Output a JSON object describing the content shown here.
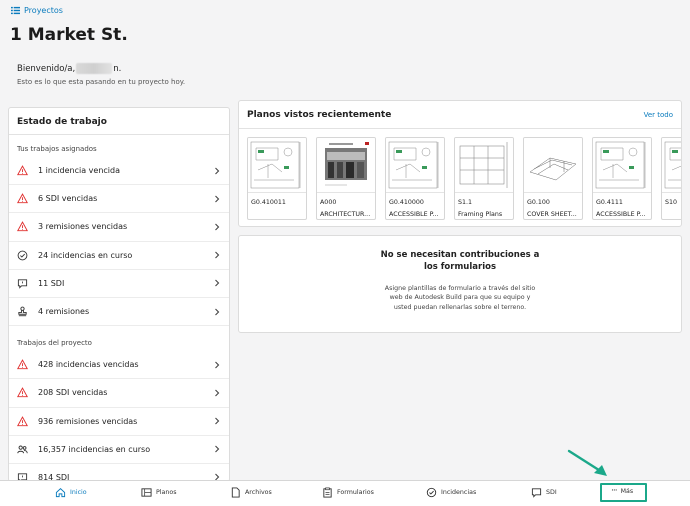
{
  "header": {
    "breadcrumb": "Proyectos",
    "title": "1 Market St.",
    "welcome_prefix": "Bienvenido/a,",
    "welcome_suffix": "n.",
    "subtitle": "Esto es lo que esta pasando en tu proyecto hoy."
  },
  "status": {
    "title": "Estado de trabajo",
    "assigned_label": "Tus trabajos asignados",
    "assigned": [
      {
        "icon": "warning-icon",
        "label": "1 incidencia vencida"
      },
      {
        "icon": "warning-icon",
        "label": "6 SDI vencidas"
      },
      {
        "icon": "warning-icon",
        "label": "3 remisiones vencidas"
      },
      {
        "icon": "check-circle-icon",
        "label": "24 incidencias en curso"
      },
      {
        "icon": "chat-bubble-icon",
        "label": "11 SDI"
      },
      {
        "icon": "stamp-icon",
        "label": "4 remisiones"
      }
    ],
    "project_label": "Trabajos del proyecto",
    "project": [
      {
        "icon": "warning-icon",
        "label": "428 incidencias vencidas"
      },
      {
        "icon": "warning-icon",
        "label": "208 SDI vencidas"
      },
      {
        "icon": "warning-icon",
        "label": "936 remisiones vencidas"
      },
      {
        "icon": "people-icon",
        "label": "16,357 incidencias en curso"
      },
      {
        "icon": "chat-bubble-icon",
        "label": "814 SDI"
      }
    ]
  },
  "recent": {
    "title": "Planos vistos recientemente",
    "view_all": "Ver todo",
    "sheets": [
      {
        "number": "G0.410011",
        "name": ""
      },
      {
        "number": "A000",
        "name": "ARCHITECTUR..."
      },
      {
        "number": "G0.410000",
        "name": "ACCESSIBLE P..."
      },
      {
        "number": "S1.1",
        "name": "Framing Plans"
      },
      {
        "number": "G0.100",
        "name": "COVER SHEET..."
      },
      {
        "number": "G0.4111",
        "name": "ACCESSIBLE P..."
      },
      {
        "number": "S10",
        "name": ""
      }
    ]
  },
  "forms": {
    "title": "No se necesitan contribuciones a los formularios",
    "body": "Asigne plantillas de formulario a través del sitio web de Autodesk Build para que su equipo y usted puedan rellenarlas sobre el terreno."
  },
  "nav": {
    "items": [
      "Inicio",
      "Planos",
      "Archivos",
      "Formularios",
      "Incidencias",
      "SDI",
      "Más"
    ]
  },
  "colors": {
    "accent": "#0a7bbd",
    "warning": "#e0302f",
    "highlight": "#1ba88a"
  }
}
